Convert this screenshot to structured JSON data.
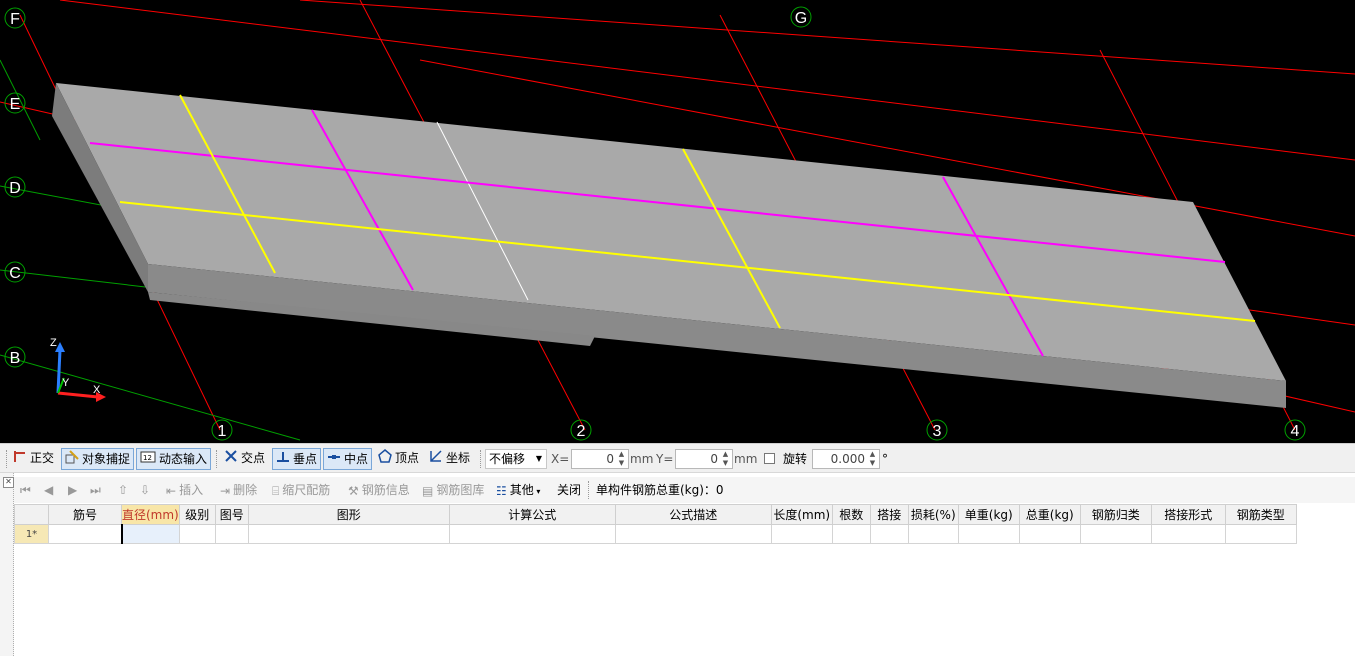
{
  "viewport": {
    "axis_labels": [
      "F",
      "E",
      "D",
      "C",
      "B",
      "G",
      "1",
      "2",
      "3",
      "4"
    ],
    "triad": {
      "z": "Z",
      "y": "Y",
      "x": "X"
    },
    "colors": {
      "background": "#000000",
      "axis_line": "#ff0000",
      "grid_line": "#00a000",
      "slab_top": "#a9a9a9",
      "slab_side": "#808080",
      "rebar_magenta": "#ff00ff",
      "rebar_yellow": "#ffff00"
    }
  },
  "snap_toolbar": {
    "ortho": "正交",
    "object_snap": "对象捕捉",
    "dynamic_input": "动态输入",
    "intersection": "交点",
    "perpendicular": "垂点",
    "midpoint": "中点",
    "vertex": "顶点",
    "coordinate": "坐标",
    "offset_select": "不偏移",
    "x_label": "X=",
    "x_value": "0",
    "x_unit": "mm",
    "y_label": "Y=",
    "y_value": "0",
    "y_unit": "mm",
    "rotate_label": "旋转",
    "rotate_value": "0.000",
    "degree": "°"
  },
  "grid_toolbar": {
    "insert": "插入",
    "delete": "删除",
    "scale_rebar": "缩尺配筋",
    "rebar_info": "钢筋信息",
    "rebar_library": "钢筋图库",
    "other": "其他",
    "close": "关闭",
    "total_weight": "单构件钢筋总重(kg)：0"
  },
  "table": {
    "columns": [
      "",
      "筋号",
      "直径(mm)",
      "级别",
      "图号",
      "图形",
      "计算公式",
      "公式描述",
      "长度(mm)",
      "根数",
      "搭接",
      "损耗(%)",
      "单重(kg)",
      "总重(kg)",
      "钢筋归类",
      "搭接形式",
      "钢筋类型"
    ],
    "rows": [
      {
        "num": "1*",
        "cells": [
          "",
          "",
          "",
          "",
          "",
          "",
          "",
          "",
          "",
          "",
          "",
          "",
          "",
          "",
          "",
          ""
        ]
      }
    ]
  }
}
